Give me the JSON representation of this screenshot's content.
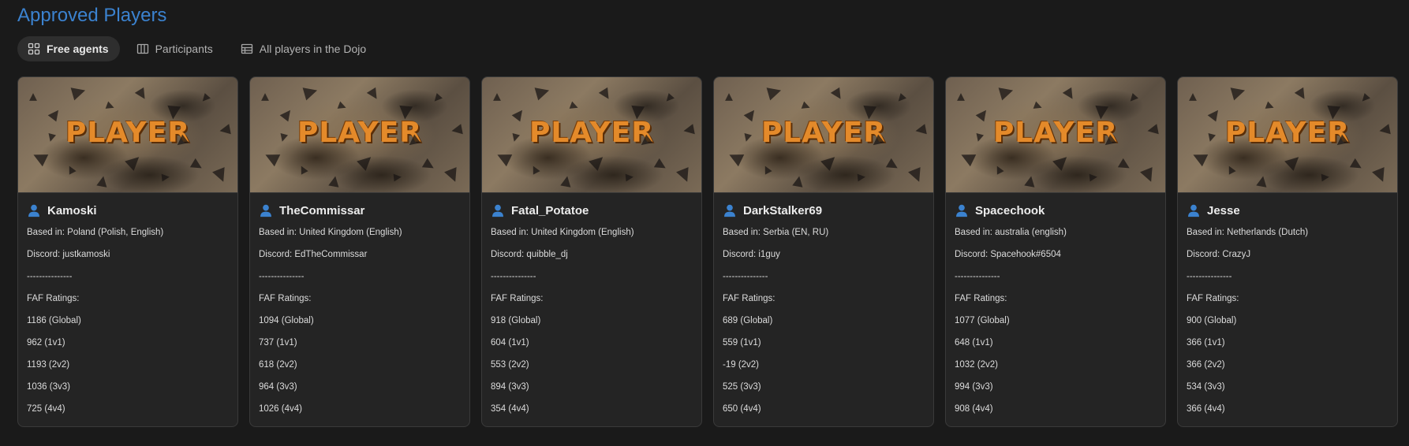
{
  "page": {
    "title": "Approved Players"
  },
  "tabs": [
    {
      "label": "Free agents",
      "icon": "grid-icon",
      "active": true
    },
    {
      "label": "Participants",
      "icon": "columns-icon",
      "active": false
    },
    {
      "label": "All players in the Dojo",
      "icon": "table-icon",
      "active": false
    }
  ],
  "card_banner_text": "PLAYER",
  "cards": [
    {
      "name": "Kamoski",
      "based_in": "Based in: Poland (Polish, English)",
      "discord": "Discord: justkamoski",
      "separator": "---------------",
      "ratings_label": "FAF Ratings:",
      "ratings": [
        "1186 (Global)",
        "962 (1v1)",
        "1193 (2v2)",
        "1036 (3v3)",
        "725 (4v4)"
      ]
    },
    {
      "name": "TheCommissar",
      "based_in": "Based in: United Kingdom (English)",
      "discord": "Discord: EdTheCommissar",
      "separator": "---------------",
      "ratings_label": "FAF Ratings:",
      "ratings": [
        "1094 (Global)",
        "737 (1v1)",
        "618 (2v2)",
        "964 (3v3)",
        "1026 (4v4)"
      ]
    },
    {
      "name": "Fatal_Potatoe",
      "based_in": "Based in: United Kingdom (English)",
      "discord": "Discord: quibble_dj",
      "separator": "---------------",
      "ratings_label": "FAF Ratings:",
      "ratings": [
        "918 (Global)",
        "604 (1v1)",
        "553 (2v2)",
        "894 (3v3)",
        "354 (4v4)"
      ]
    },
    {
      "name": "DarkStalker69",
      "based_in": "Based in: Serbia (EN, RU)",
      "discord": "Discord: i1guy",
      "separator": "---------------",
      "ratings_label": "FAF Ratings:",
      "ratings": [
        "689 (Global)",
        "559 (1v1)",
        "-19 (2v2)",
        "525 (3v3)",
        "650 (4v4)"
      ]
    },
    {
      "name": "Spacechook",
      "based_in": "Based in: australia (english)",
      "discord": "Discord: Spacehook#6504",
      "separator": "---------------",
      "ratings_label": "FAF Ratings:",
      "ratings": [
        "1077 (Global)",
        "648 (1v1)",
        "1032 (2v2)",
        "994 (3v3)",
        "908 (4v4)"
      ]
    },
    {
      "name": "Jesse",
      "based_in": "Based in: Netherlands (Dutch)",
      "discord": "Discord: CrazyJ",
      "separator": "---------------",
      "ratings_label": "FAF Ratings:",
      "ratings": [
        "900 (Global)",
        "366 (1v1)",
        "366 (2v2)",
        "534 (3v3)",
        "366 (4v4)"
      ]
    }
  ],
  "colors": {
    "accent": "#3b82cf",
    "background": "#1a1a1a",
    "card": "#242424",
    "banner_text": "#e48a2a"
  }
}
